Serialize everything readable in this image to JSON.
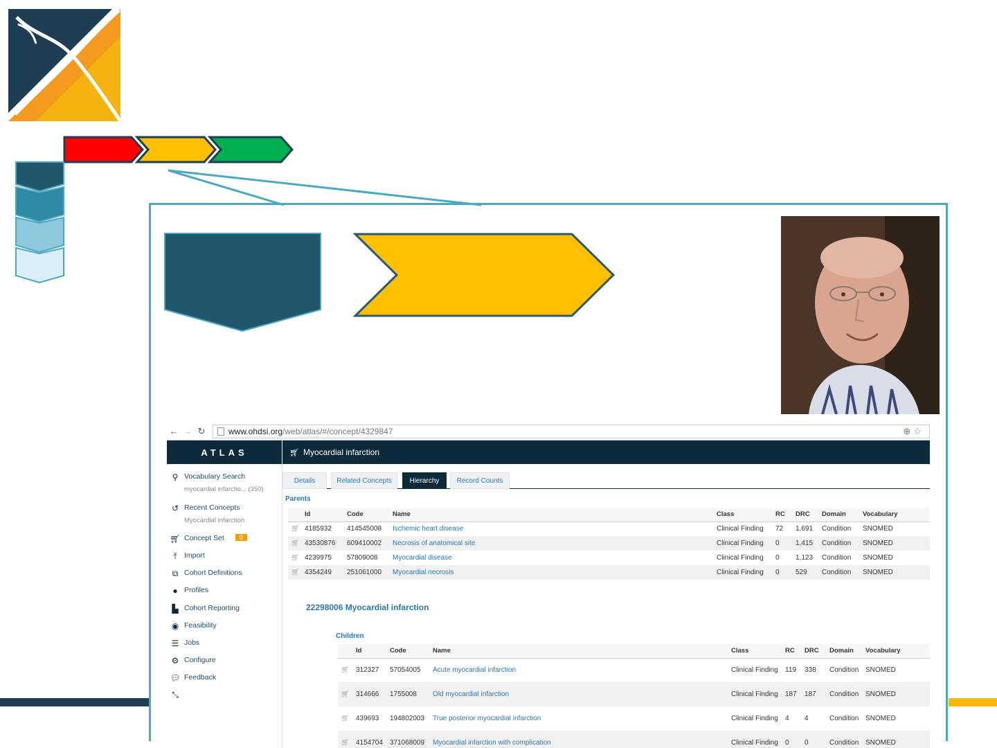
{
  "colors": {
    "navy": "#1e3f53",
    "orange": "#f39a1f",
    "gold": "#f5b90c",
    "red": "#ff0000",
    "yellow": "#ffc000",
    "green": "#00b050",
    "teal_frame": "#4ba8c2",
    "atlas_dark": "#0c2a3a",
    "link_blue": "#2a75b5",
    "badge_orange": "#f0a00a"
  },
  "browser": {
    "url_host": "www.ohdsi.org",
    "url_path": "/web/atlas/#/concept/4329847"
  },
  "atlas": {
    "brand": "ATLAS",
    "page_title": "Myocardial infarction",
    "sidebar": [
      {
        "label": "Vocabulary Search",
        "sub": "myocardial infarctio... (350)",
        "icon": "search-icon"
      },
      {
        "label": "Recent Concepts",
        "sub": "Myocardial infarction",
        "icon": "history-icon"
      },
      {
        "label": "Concept Set",
        "badge": "0",
        "icon": "cart-icon"
      },
      {
        "label": "Import",
        "icon": "upload-icon"
      },
      {
        "label": "Cohort Definitions",
        "icon": "cohort-icon"
      },
      {
        "label": "Profiles",
        "icon": "user-icon"
      },
      {
        "label": "Cohort Reporting",
        "icon": "area-chart-icon"
      },
      {
        "label": "Feasibility",
        "icon": "target-icon"
      },
      {
        "label": "Jobs",
        "icon": "server-icon"
      },
      {
        "label": "Configure",
        "icon": "gears-icon"
      },
      {
        "label": "Feedback",
        "icon": "comment-icon"
      }
    ],
    "tabs": [
      {
        "label": "Details",
        "active": false
      },
      {
        "label": "Related Concepts",
        "active": false
      },
      {
        "label": "Hierarchy",
        "active": true
      },
      {
        "label": "Record Counts",
        "active": false
      }
    ],
    "parents_label": "Parents",
    "parents_headers": [
      "Id",
      "Code",
      "Name",
      "Class",
      "RC",
      "DRC",
      "Domain",
      "Vocabulary"
    ],
    "parents_rows": [
      [
        "4185932",
        "414545008",
        "Ischemic heart disease",
        "Clinical Finding",
        "72",
        "1,691",
        "Condition",
        "SNOMED"
      ],
      [
        "43530876",
        "609410002",
        "Necrosis of anatomical site",
        "Clinical Finding",
        "0",
        "1,415",
        "Condition",
        "SNOMED"
      ],
      [
        "4239975",
        "57809008",
        "Myocardial disease",
        "Clinical Finding",
        "0",
        "1,123",
        "Condition",
        "SNOMED"
      ],
      [
        "4354249",
        "251061000",
        "Myocardial necrosis",
        "Clinical Finding",
        "0",
        "529",
        "Condition",
        "SNOMED"
      ]
    ],
    "concept_heading": "22298006 Myocardial infarction",
    "children_label": "Children",
    "children_headers": [
      "Id",
      "Code",
      "Name",
      "Class",
      "RC",
      "DRC",
      "Domain",
      "Vocabulary"
    ],
    "children_rows": [
      [
        "312327",
        "57054005",
        "Acute myocardial infarction",
        "Clinical Finding",
        "119",
        "338",
        "Condition",
        "SNOMED"
      ],
      [
        "314666",
        "1755008",
        "Old myocardial infarction",
        "Clinical Finding",
        "187",
        "187",
        "Condition",
        "SNOMED"
      ],
      [
        "439693",
        "194802003",
        "True posterior myocardial infarction",
        "Clinical Finding",
        "4",
        "4",
        "Condition",
        "SNOMED"
      ],
      [
        "4154704",
        "371068009",
        "Myocardial infarction with complication",
        "Clinical Finding",
        "0",
        "0",
        "Condition",
        "SNOMED"
      ]
    ]
  }
}
